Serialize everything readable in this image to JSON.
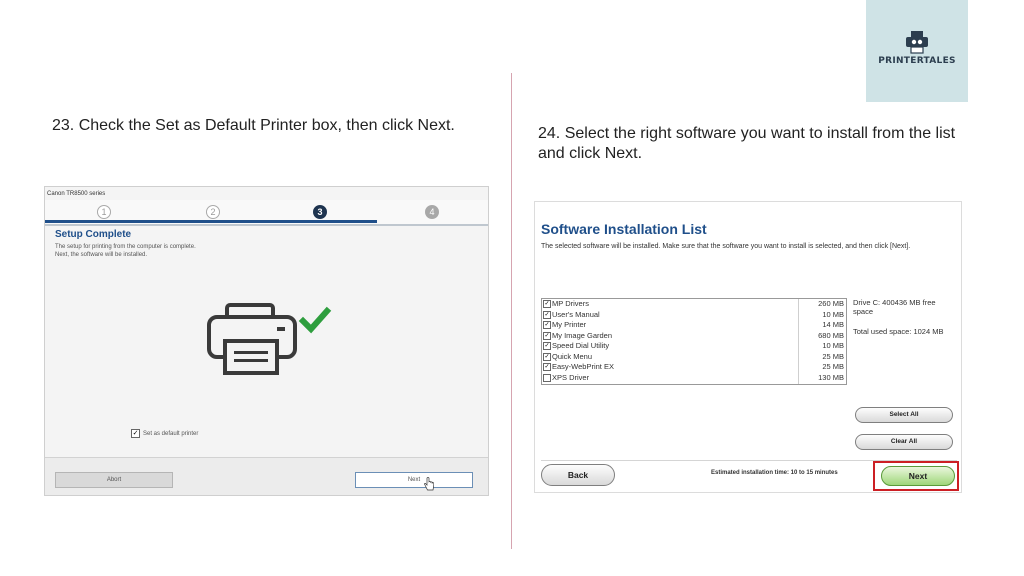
{
  "brand": {
    "logo_text": "PRINTERTALES",
    "bg_color": "#cfe3e6"
  },
  "steps": {
    "step23": "23. Check the Set as Default Printer box, then click Next.",
    "step24": "24. Select the right software you want to install from the list and click Next."
  },
  "left_dialog": {
    "window_title": "Canon TR8500 series",
    "step_numbers": [
      "1",
      "2",
      "3",
      "4"
    ],
    "active_step": "3",
    "heading": "Setup Complete",
    "desc_line1": "The setup for printing from the computer is complete.",
    "desc_line2": "Next, the software will be installed.",
    "checkbox_label": "Set as default printer",
    "checkbox_checked": true,
    "abort_label": "Abort",
    "next_label": "Next",
    "accent_color": "#1f4f8a",
    "check_color": "#2e9e3e"
  },
  "right_dialog": {
    "title": "Software Installation List",
    "description": "The selected software will be installed. Make sure that the software you want to install is selected, and then click [Next].",
    "software": [
      {
        "name": "MP Drivers",
        "size": "260 MB",
        "checked": true
      },
      {
        "name": "User's Manual",
        "size": "10 MB",
        "checked": true
      },
      {
        "name": "My Printer",
        "size": "14 MB",
        "checked": true
      },
      {
        "name": "My Image Garden",
        "size": "680 MB",
        "checked": true
      },
      {
        "name": "Speed Dial Utility",
        "size": "10 MB",
        "checked": true
      },
      {
        "name": "Quick Menu",
        "size": "25 MB",
        "checked": true
      },
      {
        "name": "Easy-WebPrint EX",
        "size": "25 MB",
        "checked": true
      },
      {
        "name": "XPS Driver",
        "size": "130 MB",
        "checked": false
      }
    ],
    "drive_info": "Drive C: 400436 MB free space",
    "total_space": "Total used space: 1024 MB",
    "select_all_label": "Select All",
    "clear_all_label": "Clear All",
    "back_label": "Back",
    "estimated_time": "Estimated installation time: 10 to 15 minutes",
    "next_label": "Next",
    "highlight_color": "#cc1f24"
  }
}
